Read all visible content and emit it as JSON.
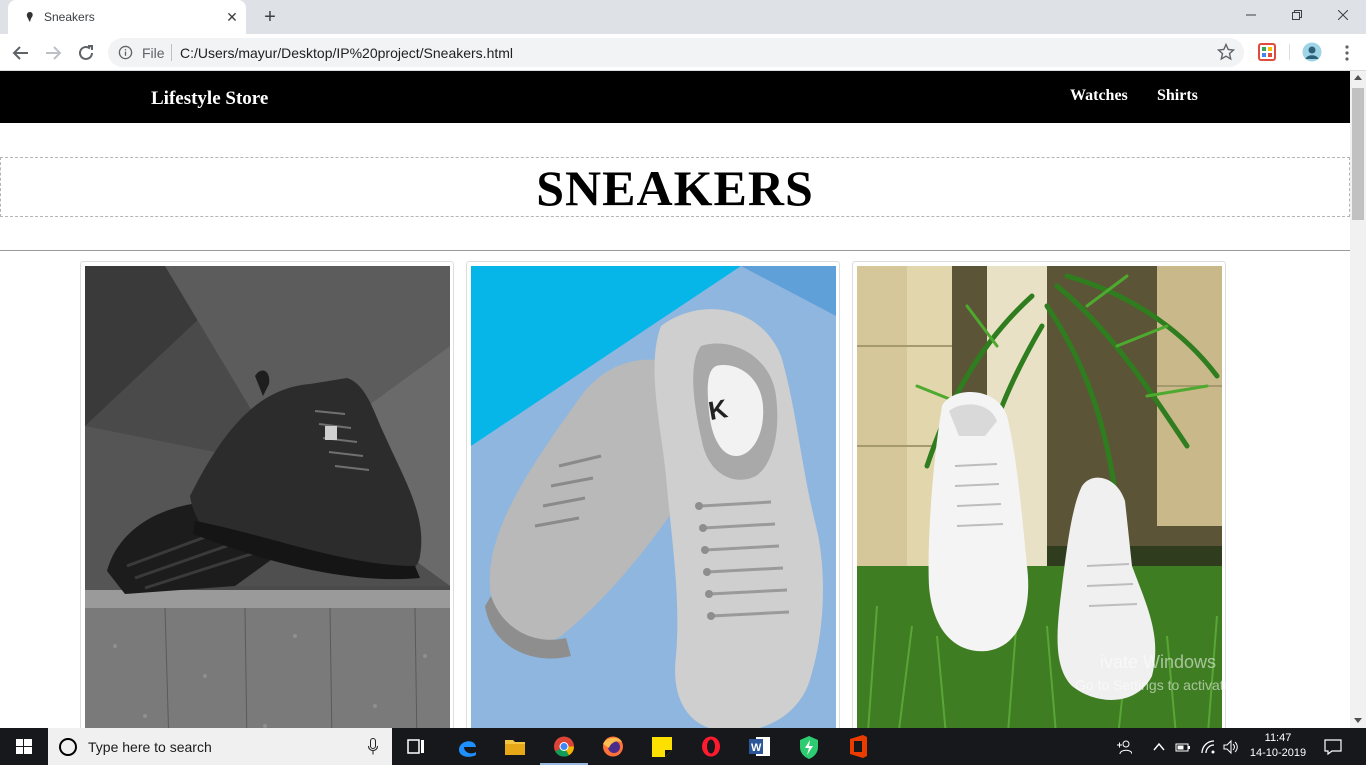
{
  "browser": {
    "tab": {
      "title": "Sneakers"
    },
    "address": {
      "scheme_label": "File",
      "url": "C:/Users/mayur/Desktop/IP%20project/Sneakers.html"
    }
  },
  "page": {
    "brand": "Lifestyle Store",
    "nav": [
      {
        "label": "Watches"
      },
      {
        "label": "Shirts"
      }
    ],
    "heading": "SNEAKERS",
    "products": [
      {
        "image_alt": "Black sneakers on concrete block"
      },
      {
        "image_alt": "Grey sneakers on blue background"
      },
      {
        "image_alt": "White sneakers on grass"
      }
    ]
  },
  "watermark": {
    "line1": "ivate Windows",
    "line2": "Go to Settings to activate Windows."
  },
  "taskbar": {
    "search_placeholder": "Type here to search",
    "clock": {
      "time": "11:47",
      "date": "14-10-2019"
    }
  },
  "colors": {
    "navbar": "#000000",
    "tabstrip": "#dee1e6",
    "taskbar": "#16181c"
  }
}
